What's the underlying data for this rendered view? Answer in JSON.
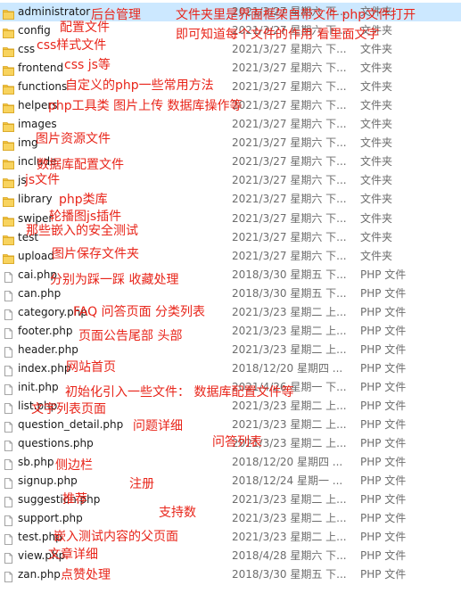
{
  "files": [
    {
      "name": "administrator",
      "date": "2021/3/27 星期六 下...",
      "type": "文件夹",
      "kind": "folder"
    },
    {
      "name": "config",
      "date": "2021/3/27 星期六 下...",
      "type": "文件夹",
      "kind": "folder"
    },
    {
      "name": "css",
      "date": "2021/3/27 星期六 下...",
      "type": "文件夹",
      "kind": "folder"
    },
    {
      "name": "frontend",
      "date": "2021/3/27 星期六 下...",
      "type": "文件夹",
      "kind": "folder"
    },
    {
      "name": "functions",
      "date": "2021/3/27 星期六 下...",
      "type": "文件夹",
      "kind": "folder"
    },
    {
      "name": "helpers",
      "date": "2021/3/27 星期六 下...",
      "type": "文件夹",
      "kind": "folder"
    },
    {
      "name": "images",
      "date": "2021/3/27 星期六 下...",
      "type": "文件夹",
      "kind": "folder"
    },
    {
      "name": "img",
      "date": "2021/3/27 星期六 下...",
      "type": "文件夹",
      "kind": "folder"
    },
    {
      "name": "include",
      "date": "2021/3/27 星期六 下...",
      "type": "文件夹",
      "kind": "folder"
    },
    {
      "name": "js",
      "date": "2021/3/27 星期六 下...",
      "type": "文件夹",
      "kind": "folder"
    },
    {
      "name": "library",
      "date": "2021/3/27 星期六 下...",
      "type": "文件夹",
      "kind": "folder"
    },
    {
      "name": "swiper",
      "date": "2021/3/27 星期六 下...",
      "type": "文件夹",
      "kind": "folder"
    },
    {
      "name": "test",
      "date": "2021/3/27 星期六 下...",
      "type": "文件夹",
      "kind": "folder"
    },
    {
      "name": "upload",
      "date": "2021/3/27 星期六 下...",
      "type": "文件夹",
      "kind": "folder"
    },
    {
      "name": "cai.php",
      "date": "2018/3/30 星期五 下...",
      "type": "PHP 文件",
      "kind": "file"
    },
    {
      "name": "can.php",
      "date": "2018/3/30 星期五 下...",
      "type": "PHP 文件",
      "kind": "file"
    },
    {
      "name": "category.php",
      "date": "2021/3/23 星期二 上...",
      "type": "PHP 文件",
      "kind": "file"
    },
    {
      "name": "footer.php",
      "date": "2021/3/23 星期二 上...",
      "type": "PHP 文件",
      "kind": "file"
    },
    {
      "name": "header.php",
      "date": "2021/3/23 星期二 上...",
      "type": "PHP 文件",
      "kind": "file"
    },
    {
      "name": "index.php",
      "date": "2018/12/20 星期四 ...",
      "type": "PHP 文件",
      "kind": "file"
    },
    {
      "name": "init.php",
      "date": "2021/4/26 星期一 下...",
      "type": "PHP 文件",
      "kind": "file"
    },
    {
      "name": "list.php",
      "date": "2021/3/23 星期二 上...",
      "type": "PHP 文件",
      "kind": "file"
    },
    {
      "name": "question_detail.php",
      "date": "2021/3/23 星期二 上...",
      "type": "PHP 文件",
      "kind": "file"
    },
    {
      "name": "questions.php",
      "date": "2021/3/23 星期二 上...",
      "type": "PHP 文件",
      "kind": "file"
    },
    {
      "name": "sb.php",
      "date": "2018/12/20 星期四 ...",
      "type": "PHP 文件",
      "kind": "file"
    },
    {
      "name": "signup.php",
      "date": "2018/12/24 星期一 ...",
      "type": "PHP 文件",
      "kind": "file"
    },
    {
      "name": "suggestion.php",
      "date": "2021/3/23 星期二 上...",
      "type": "PHP 文件",
      "kind": "file"
    },
    {
      "name": "support.php",
      "date": "2021/3/23 星期二 上...",
      "type": "PHP 文件",
      "kind": "file"
    },
    {
      "name": "test.php",
      "date": "2021/3/23 星期二 上...",
      "type": "PHP 文件",
      "kind": "file"
    },
    {
      "name": "view.php",
      "date": "2018/4/28 星期六 下...",
      "type": "PHP 文件",
      "kind": "file"
    },
    {
      "name": "zan.php",
      "date": "2018/3/30 星期五 下...",
      "type": "PHP 文件",
      "kind": "file"
    }
  ],
  "annotations": {
    "admin": "后台管理",
    "top1": "文件夹里是界面框架自带文件  php文件打开",
    "top2": "即可知道每个文件的作用 看里面文字",
    "config": "配置文件",
    "css": "css样式文件",
    "frontend": "css js等",
    "functions": "自定义的php一些常用方法",
    "helpers": "php工具类 图片上传 数据库操作等",
    "img": "图片资源文件",
    "include": "数据库配置文件",
    "js": "js文件",
    "library": "php类库",
    "swiper": "轮播图js插件",
    "test": "那些嵌入的安全测试",
    "upload": "图片保存文件夹",
    "caican": "分别为踩一踩 收藏处理",
    "category": "FAQ 问答页面 分类列表",
    "footer": "页面公告尾部 头部",
    "index": "网站首页",
    "init": "初始化引入一些文件：  数据库配置文件等",
    "list": "文字列表页面",
    "qdetail": "问题详细",
    "questions": "问答列表",
    "sb": "侧边栏",
    "signup": "注册",
    "suggestion": "推荐",
    "support": "支持数",
    "testphp": "嵌入测试内容的父页面",
    "view": "文章详细",
    "zan": "点赞处理"
  },
  "colors": {
    "folder": "#f4c542",
    "annotation": "#e8251a",
    "selected": "#cce8ff"
  }
}
